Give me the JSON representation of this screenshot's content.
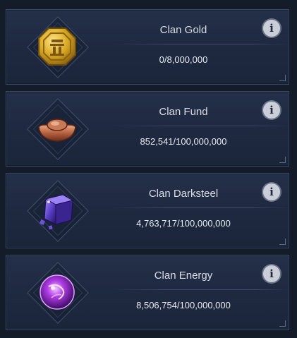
{
  "resources": [
    {
      "id": "gold",
      "title": "Clan Gold",
      "amount": "0/8,000,000",
      "icon": "gold-coin-icon"
    },
    {
      "id": "fund",
      "title": "Clan Fund",
      "amount": "852,541/100,000,000",
      "icon": "fund-ingot-icon"
    },
    {
      "id": "darksteel",
      "title": "Clan Darksteel",
      "amount": "4,763,717/100,000,000",
      "icon": "darksteel-cube-icon"
    },
    {
      "id": "energy",
      "title": "Clan Energy",
      "amount": "8,506,754/100,000,000",
      "icon": "energy-orb-icon"
    }
  ],
  "info_glyph": "i",
  "colors": {
    "panel": "#1e2940",
    "border": "#3a4863",
    "text": "#e8ebf1",
    "gold": "#d9a920",
    "fund": "#b5623f",
    "darksteel": "#5b3fc9",
    "energy": "#b23de8"
  }
}
